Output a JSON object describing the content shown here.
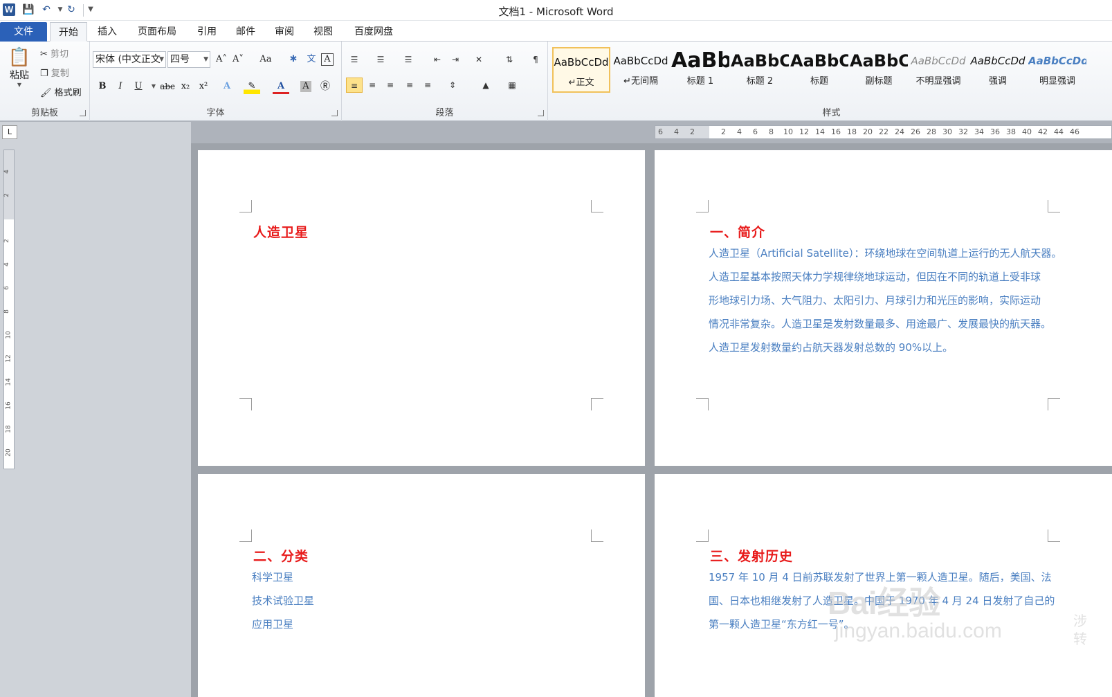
{
  "window": {
    "app_letter": "W",
    "title": "文档1 - Microsoft Word"
  },
  "quick_access": {
    "save_icon": "save-icon",
    "undo_icon": "undo-icon",
    "redo_icon": "redo-icon",
    "customize_icon": "customize-icon"
  },
  "tabs": [
    "文件",
    "开始",
    "插入",
    "页面布局",
    "引用",
    "邮件",
    "审阅",
    "视图",
    "百度网盘"
  ],
  "active_tab": "开始",
  "clipboard": {
    "paste": "粘贴",
    "cut": "剪切",
    "copy": "复制",
    "format_painter": "格式刷",
    "label": "剪贴板"
  },
  "font": {
    "name": "宋体 (中文正文",
    "size": "四号",
    "label": "字体",
    "grow": "A˄",
    "shrink": "A˅",
    "case": "Aa",
    "bold": "B",
    "italic": "I",
    "underline": "U",
    "strike": "abc",
    "subscript": "x₂",
    "superscript": "x²",
    "color_letter": "A"
  },
  "paragraph": {
    "label": "段落"
  },
  "styles": {
    "label": "样式",
    "items": [
      {
        "preview": "AaBbCcDd",
        "name": "↵正文"
      },
      {
        "preview": "AaBbCcDd",
        "name": "↵无间隔"
      },
      {
        "preview": "AaBb",
        "name": "标题 1"
      },
      {
        "preview": "AaBbC",
        "name": "标题 2"
      },
      {
        "preview": "AaBbC",
        "name": "标题"
      },
      {
        "preview": "AaBbC",
        "name": "副标题"
      },
      {
        "preview": "AaBbCcDd",
        "name": "不明显强调"
      },
      {
        "preview": "AaBbCcDd",
        "name": "强调"
      },
      {
        "preview": "AaBbCcDd",
        "name": "明显强调"
      }
    ]
  },
  "ruler": {
    "corner": "L",
    "h_ticks": [
      "6",
      "4",
      "2",
      "2",
      "4",
      "6",
      "8",
      "10",
      "12",
      "14",
      "16",
      "18",
      "20",
      "22",
      "24",
      "26",
      "28",
      "30",
      "32",
      "34",
      "36",
      "38",
      "40",
      "42",
      "44",
      "46"
    ],
    "v_ticks": [
      "4",
      "2",
      "2",
      "4",
      "6",
      "8",
      "10",
      "12",
      "14",
      "16",
      "18",
      "20"
    ]
  },
  "pages": {
    "p1_heading": "人造卫星",
    "p2_heading": "一、简介",
    "p2_lines": [
      "人造卫星（Artificial Satellite）：环绕地球在空间轨道上运行的无人航天器。",
      "人造卫星基本按照天体力学规律绕地球运动，但因在不同的轨道上受非球",
      "形地球引力场、大气阻力、太阳引力、月球引力和光压的影响，实际运动",
      "情况非常复杂。人造卫星是发射数量最多、用途最广、发展最快的航天器。",
      "人造卫星发射数量约占航天器发射总数的 90%以上。"
    ],
    "p3_heading": "二、分类",
    "p3_lines": [
      "科学卫星",
      "技术试验卫星",
      "应用卫星"
    ],
    "p4_heading": "三、发射历史",
    "p4_lines": [
      "1957 年 10 月 4 日前苏联发射了世界上第一颗人造卫星。随后，美国、法",
      "国、日本也相继发射了人造卫星。中国于 1970 年 4 月 24 日发射了自己的",
      "第一颗人造卫星“东方红一号”。"
    ]
  },
  "watermark": {
    "logo": "Bai经验",
    "url": "jingyan.baidu.com",
    "side": "涉 转"
  }
}
